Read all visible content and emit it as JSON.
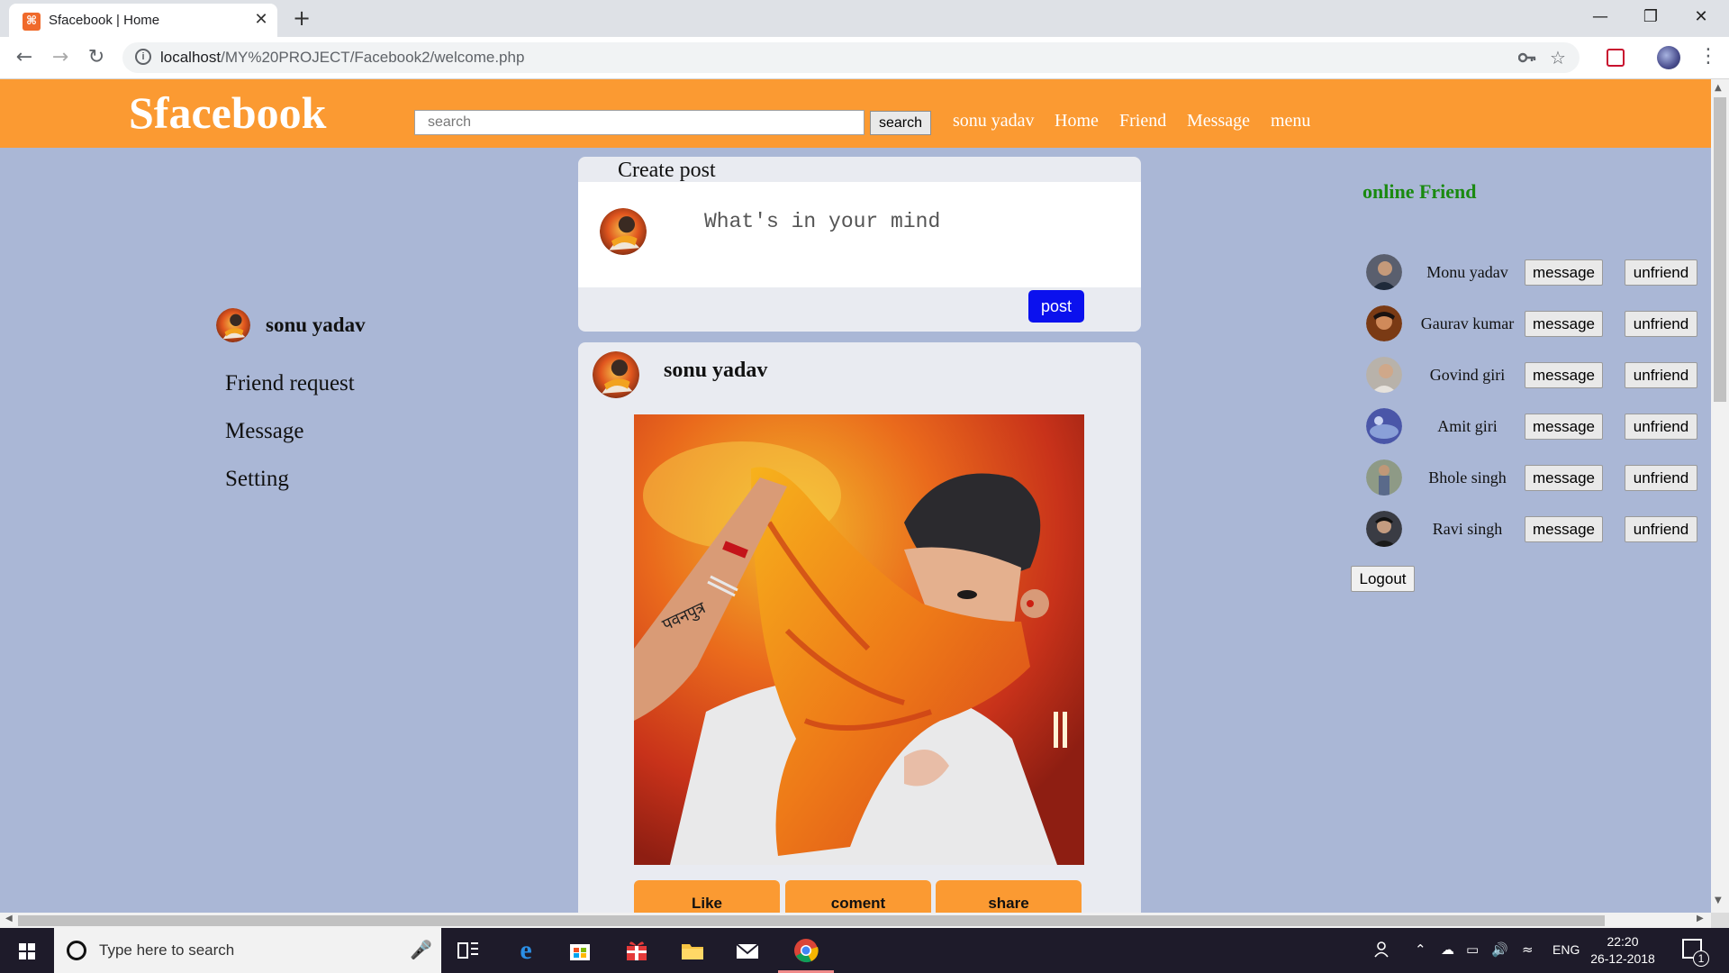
{
  "browser": {
    "tab_title": "Sfacebook | Home",
    "tab_favicon_glyph": "⌘",
    "close_glyph": "✕",
    "new_tab_glyph": "+",
    "url_host": "localhost",
    "url_path": "/MY%20PROJECT/Facebook2/welcome.php",
    "nav": {
      "back": "←",
      "forward": "→",
      "reload": "↻"
    },
    "window": {
      "minimize": "—",
      "restore": "❐",
      "close": "✕"
    },
    "icons": {
      "key": "key-icon",
      "star": "☆",
      "menu": "⋮"
    }
  },
  "header": {
    "logo": "Sfacebook",
    "search_placeholder": "search",
    "search_button": "search",
    "links": [
      "sonu yadav",
      "Home",
      "Friend",
      "Message",
      "menu"
    ]
  },
  "left_sidebar": {
    "user_name": "sonu yadav",
    "links": [
      "Friend request",
      "Message",
      "Setting"
    ]
  },
  "create_post": {
    "title": "Create post",
    "placeholder": "What's in your mind",
    "post_button": "post"
  },
  "feed_post": {
    "author": "sonu yadav",
    "image_caption_glyph": "૪નપુત્ર",
    "actions": [
      "Like",
      "coment",
      "share"
    ]
  },
  "right_sidebar": {
    "title": "online Friend",
    "friends": [
      {
        "name": "Monu yadav",
        "message": "message",
        "unfriend": "unfriend"
      },
      {
        "name": "Gaurav kumar",
        "message": "message",
        "unfriend": "unfriend"
      },
      {
        "name": "Govind giri",
        "message": "message",
        "unfriend": "unfriend"
      },
      {
        "name": "Amit giri",
        "message": "message",
        "unfriend": "unfriend"
      },
      {
        "name": "Bhole singh",
        "message": "message",
        "unfriend": "unfriend"
      },
      {
        "name": "Ravi singh",
        "message": "message",
        "unfriend": "unfriend"
      }
    ],
    "logout": "Logout"
  },
  "taskbar": {
    "search_placeholder": "Type here to search",
    "language": "ENG",
    "time": "22:20",
    "date": "26-12-2018",
    "notification_count": "1"
  },
  "colors": {
    "header_orange": "#fb9a32",
    "page_background": "#aab7d6",
    "post_button_blue": "#0b11ee",
    "online_title_green": "#1a8a10"
  }
}
